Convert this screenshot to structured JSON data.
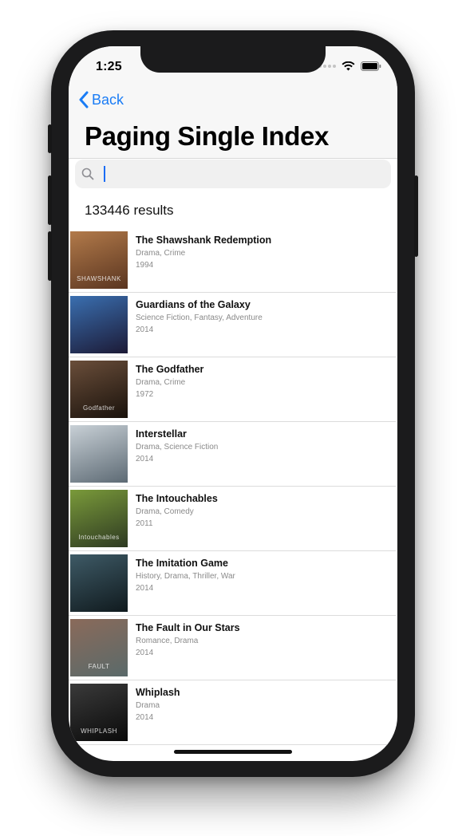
{
  "status_bar": {
    "time": "1:25"
  },
  "nav": {
    "back_label": "Back",
    "title": "Paging Single Index"
  },
  "search": {
    "value": "",
    "placeholder": ""
  },
  "results": {
    "count_text": "133446 results"
  },
  "movies": [
    {
      "title": "The Shawshank Redemption",
      "genres": "Drama, Crime",
      "year": "1994",
      "poster_text": "SHAWSHANK",
      "poster_colors": [
        "#b27a4a",
        "#5a3520"
      ]
    },
    {
      "title": "Guardians of the Galaxy",
      "genres": "Science Fiction, Fantasy, Adventure",
      "year": "2014",
      "poster_text": "",
      "poster_colors": [
        "#3a6fb0",
        "#1c1a36"
      ]
    },
    {
      "title": "The Godfather",
      "genres": "Drama, Crime",
      "year": "1972",
      "poster_text": "Godfather",
      "poster_colors": [
        "#6a4e3a",
        "#1a120c"
      ]
    },
    {
      "title": "Interstellar",
      "genres": "Drama, Science Fiction",
      "year": "2014",
      "poster_text": "",
      "poster_colors": [
        "#c8d0d6",
        "#5d6a74"
      ]
    },
    {
      "title": "The Intouchables",
      "genres": "Drama, Comedy",
      "year": "2011",
      "poster_text": "Intouchables",
      "poster_colors": [
        "#7a9a3a",
        "#2e3a22"
      ]
    },
    {
      "title": "The Imitation Game",
      "genres": "History, Drama, Thriller, War",
      "year": "2014",
      "poster_text": "",
      "poster_colors": [
        "#3e5a66",
        "#101a1e"
      ]
    },
    {
      "title": "The Fault in Our Stars",
      "genres": "Romance, Drama",
      "year": "2014",
      "poster_text": "FAULT",
      "poster_colors": [
        "#8a6a5a",
        "#5a6a6a"
      ]
    },
    {
      "title": "Whiplash",
      "genres": "Drama",
      "year": "2014",
      "poster_text": "WHIPLASH",
      "poster_colors": [
        "#3a3a3a",
        "#0a0a0a"
      ]
    }
  ],
  "colors": {
    "accent": "#1a7cf5",
    "nav_background": "#f7f7f7",
    "device_frame": "#1b1b1c",
    "search_background": "#f0f0f0"
  }
}
